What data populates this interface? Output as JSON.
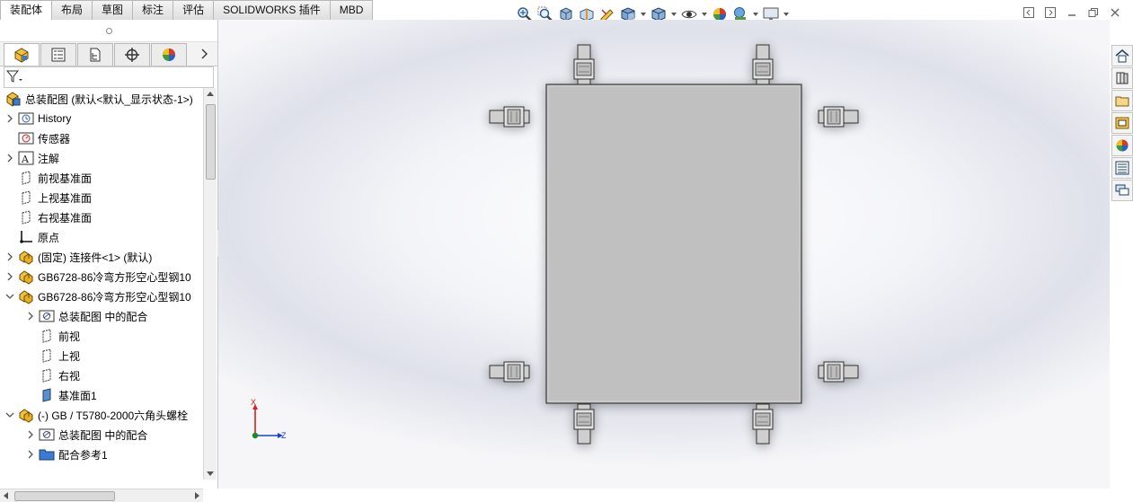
{
  "tabs": [
    "装配体",
    "布局",
    "草图",
    "标注",
    "评估",
    "SOLIDWORKS 插件",
    "MBD"
  ],
  "active_tab_index": 0,
  "hud_icons": [
    "zoom-to-fit-icon",
    "zoom-to-area-icon",
    "previous-view-icon",
    "section-view-icon",
    "dynamic-annotation-icon",
    "view-orientation-icon",
    "display-style-icon",
    "hide-show-items-icon",
    "edit-appearance-icon",
    "apply-scene-icon",
    "view-settings-icon"
  ],
  "panel_tab_icons": [
    "feature-manager-icon",
    "property-manager-icon",
    "configuration-manager-icon",
    "dimxpert-manager-icon",
    "display-manager-icon"
  ],
  "tree": {
    "root": "总装配图 (默认<默认_显示状态-1>)",
    "items": [
      {
        "label": "History",
        "icon": "history-icon",
        "expand": "collapsed",
        "level": 1
      },
      {
        "label": "传感器",
        "icon": "sensor-icon",
        "expand": "none",
        "level": 1
      },
      {
        "label": "注解",
        "icon": "annotation-icon",
        "expand": "collapsed",
        "level": 1
      },
      {
        "label": "前视基准面",
        "icon": "plane-icon",
        "expand": "none",
        "level": 1
      },
      {
        "label": "上视基准面",
        "icon": "plane-icon",
        "expand": "none",
        "level": 1
      },
      {
        "label": "右视基准面",
        "icon": "plane-icon",
        "expand": "none",
        "level": 1
      },
      {
        "label": "原点",
        "icon": "origin-icon",
        "expand": "none",
        "level": 1
      },
      {
        "label": "(固定) 连接件<1> (默认)",
        "icon": "part-icon",
        "expand": "collapsed",
        "level": 1
      },
      {
        "label": "GB6728-86冷弯方形空心型钢10",
        "icon": "part-icon",
        "expand": "collapsed",
        "level": 1
      },
      {
        "label": "GB6728-86冷弯方形空心型钢10",
        "icon": "part-icon",
        "expand": "expanded",
        "level": 1
      },
      {
        "label": "总装配图 中的配合",
        "icon": "mates-folder-icon",
        "expand": "collapsed",
        "level": 2
      },
      {
        "label": "前视",
        "icon": "plane-icon",
        "expand": "none",
        "level": 2
      },
      {
        "label": "上视",
        "icon": "plane-icon",
        "expand": "none",
        "level": 2
      },
      {
        "label": "右视",
        "icon": "plane-icon",
        "expand": "none",
        "level": 2
      },
      {
        "label": "基准面1",
        "icon": "plane-blue-icon",
        "expand": "none",
        "level": 2
      },
      {
        "label": "(-) GB / T5780-2000六角头螺栓",
        "icon": "part-icon",
        "expand": "expanded",
        "level": 1
      },
      {
        "label": "总装配图 中的配合",
        "icon": "mates-folder-icon",
        "expand": "collapsed",
        "level": 2
      },
      {
        "label": "配合参考1",
        "icon": "folder-icon",
        "expand": "collapsed",
        "level": 2
      }
    ]
  },
  "triad": {
    "axis_x": "X",
    "axis_z": "Z",
    "x_color": "#d42020",
    "z_color": "#1a3fd6",
    "origin_color": "#1a8a2a"
  },
  "taskpane_icons": [
    "solidworks-resources-icon",
    "design-library-icon",
    "file-explorer-icon",
    "view-palette-icon",
    "appearances-icon",
    "custom-properties-icon",
    "forum-icon"
  ],
  "colors": {
    "model_body": "#c0c0c0",
    "model_edge": "#3a3a3a",
    "viewport_bg": "#eef0f5"
  }
}
